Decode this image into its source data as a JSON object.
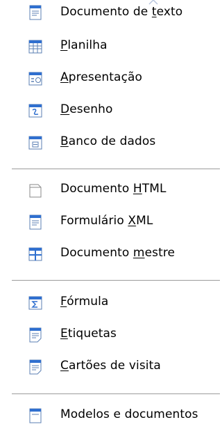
{
  "menu": {
    "items": [
      {
        "id": "documento-de-texto",
        "pre": "Documento de ",
        "ul": "t",
        "post": "exto",
        "icon": "text-document-icon"
      },
      {
        "id": "planilha",
        "pre": "",
        "ul": "P",
        "post": "lanilha",
        "icon": "spreadsheet-icon"
      },
      {
        "id": "apresentacao",
        "pre": "",
        "ul": "A",
        "post": "presentação",
        "icon": "presentation-icon"
      },
      {
        "id": "desenho",
        "pre": "",
        "ul": "D",
        "post": "esenho",
        "icon": "drawing-icon"
      },
      {
        "id": "banco-de-dados",
        "pre": "",
        "ul": "B",
        "post": "anco de dados",
        "icon": "database-icon"
      },
      {
        "id": "documento-html",
        "pre": "Documento ",
        "ul": "H",
        "post": "TML",
        "icon": "html-document-icon"
      },
      {
        "id": "formulario-xml",
        "pre": "Formulário ",
        "ul": "X",
        "post": "ML",
        "icon": "xml-form-icon"
      },
      {
        "id": "documento-mestre",
        "pre": "Documento ",
        "ul": "m",
        "post": "estre",
        "icon": "master-document-icon"
      },
      {
        "id": "formula",
        "pre": "",
        "ul": "F",
        "post": "órmula",
        "icon": "formula-icon"
      },
      {
        "id": "etiquetas",
        "pre": "",
        "ul": "E",
        "post": "tiquetas",
        "icon": "labels-icon"
      },
      {
        "id": "cartoes-de-visita",
        "pre": "",
        "ul": "C",
        "post": "artões de visita",
        "icon": "business-cards-icon"
      },
      {
        "id": "modelos-e-documentos",
        "pre": "Modelos e documentos",
        "ul": "",
        "post": "",
        "icon": "templates-icon"
      }
    ]
  }
}
